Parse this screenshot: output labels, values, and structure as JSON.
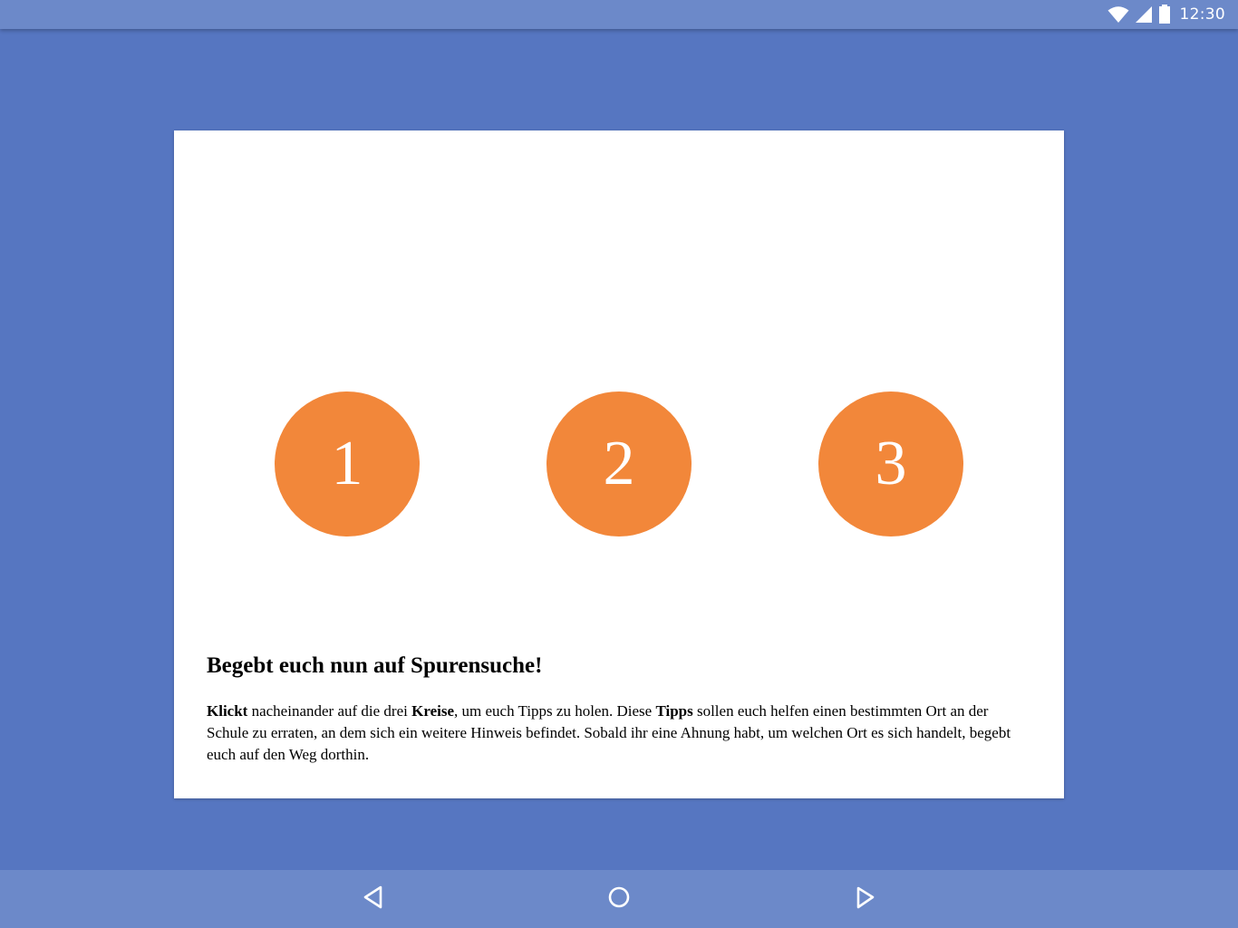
{
  "status_bar": {
    "time": "12:30",
    "icons": [
      "wifi-icon",
      "cell-signal-icon",
      "battery-icon"
    ]
  },
  "card": {
    "circles": [
      {
        "label": "1"
      },
      {
        "label": "2"
      },
      {
        "label": "3"
      }
    ],
    "headline": "Begebt euch nun auf Spurensuche!",
    "paragraph": {
      "w1": "Klickt",
      "t1": " nacheinander auf die drei ",
      "w2": "Kreise",
      "t2": ", um euch Tipps zu holen. Diese ",
      "w3": "Tipps",
      "t3": " sollen euch helfen einen bestimmten Ort an der Schule zu erraten, an dem sich ein weitere Hinweis befindet. Sobald ihr eine Ahnung habt, um welchen Ort es sich handelt, begebt euch auf den Weg dorthin."
    }
  },
  "nav_bar": {
    "icons": [
      "back-triangle-icon",
      "home-circle-icon",
      "forward-triangle-icon"
    ]
  },
  "colors": {
    "background": "#5676c1",
    "bars": "#6c89c9",
    "circle": "#f2873a",
    "card": "#ffffff"
  }
}
